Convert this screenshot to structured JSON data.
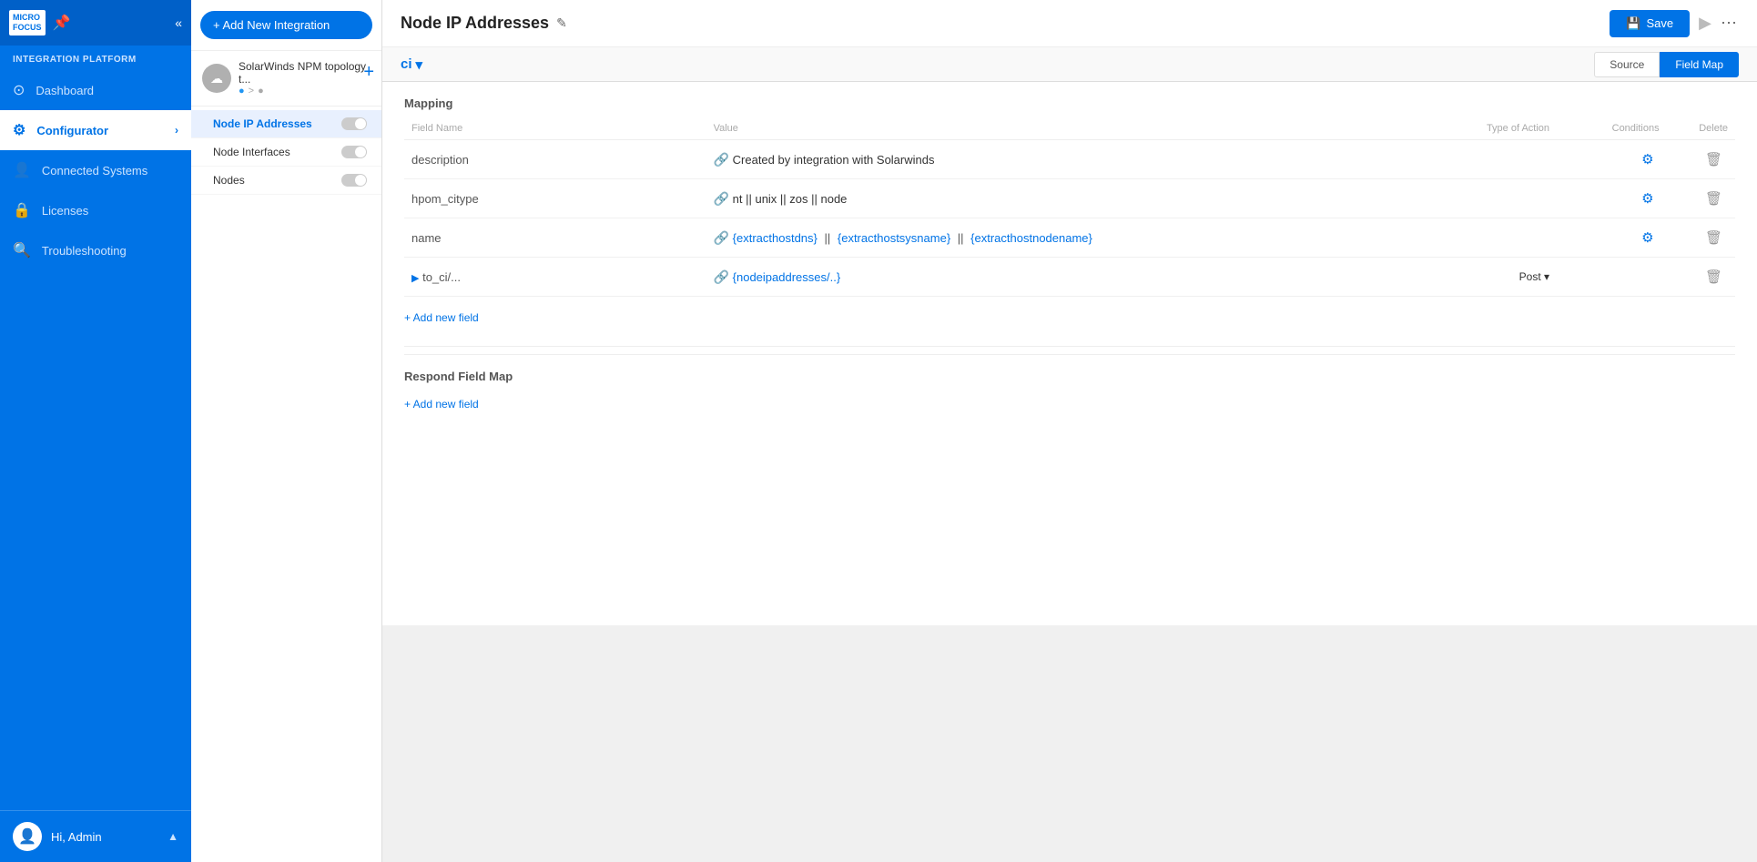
{
  "sidebar": {
    "logo_line1": "MICRO",
    "logo_line2": "FOCUS",
    "platform_title": "INTEGRATION PLATFORM",
    "nav_items": [
      {
        "id": "dashboard",
        "label": "Dashboard",
        "icon": "⊙",
        "active": false
      },
      {
        "id": "configurator",
        "label": "Configurator",
        "icon": "⚙",
        "active": true,
        "has_arrow": true
      },
      {
        "id": "connected-systems",
        "label": "Connected Systems",
        "icon": "👤",
        "active": false
      },
      {
        "id": "licenses",
        "label": "Licenses",
        "icon": "🔒",
        "active": false
      },
      {
        "id": "troubleshooting",
        "label": "Troubleshooting",
        "icon": "🔍",
        "active": false
      }
    ],
    "footer": {
      "user_name": "Hi, Admin"
    }
  },
  "middle_panel": {
    "add_button_label": "+ Add New Integration",
    "integration": {
      "name": "SolarWinds NPM topology t...",
      "icons_text": "● > ●"
    },
    "sub_items": [
      {
        "label": "Node IP Addresses",
        "active": true
      },
      {
        "label": "Node Interfaces",
        "active": false
      },
      {
        "label": "Nodes",
        "active": false
      }
    ]
  },
  "main": {
    "page_title": "Node IP Addresses",
    "edit_icon": "✎",
    "save_label": "Save",
    "run_icon": "▶",
    "more_icon": "⋯",
    "ci_selector": "ci",
    "tabs": [
      {
        "label": "Source",
        "active": false
      },
      {
        "label": "Field Map",
        "active": true
      }
    ],
    "mapping": {
      "section_label": "Mapping",
      "columns": {
        "field_name": "Field Name",
        "value": "Value",
        "type_of_action": "Type of Action",
        "conditions": "Conditions",
        "delete": "Delete"
      },
      "rows": [
        {
          "field_name": "description",
          "link_icon": "🔗",
          "value": "Created by integration with Solarwinds",
          "value_type": "plain",
          "type_of_action": "",
          "has_gear": true,
          "has_delete": true
        },
        {
          "field_name": "hpom_citype",
          "link_icon": "🔗",
          "value": "nt || unix || zos || node",
          "value_type": "plain",
          "type_of_action": "",
          "has_gear": true,
          "has_delete": true
        },
        {
          "field_name": "name",
          "link_icon": "🔗",
          "value_parts": [
            {
              "text": "{extracthostdns}",
              "blue": true
            },
            {
              "text": " || ",
              "blue": false
            },
            {
              "text": "{extracthostsysname}",
              "blue": true
            },
            {
              "text": " || ",
              "blue": false
            },
            {
              "text": "{extracthostnodename}",
              "blue": true
            }
          ],
          "value_type": "parts",
          "type_of_action": "",
          "has_gear": true,
          "has_delete": true
        },
        {
          "field_name": "to_ci/...",
          "link_icon": "🔗",
          "value": "{nodeipaddresses/..}",
          "value_type": "blue",
          "type_of_action": "Post ▾",
          "has_expand": true,
          "has_gear": false,
          "has_delete": true
        }
      ],
      "add_field_label": "+ Add new field"
    },
    "respond_mapping": {
      "section_label": "Respond Field Map",
      "add_field_label": "+ Add new field"
    }
  }
}
